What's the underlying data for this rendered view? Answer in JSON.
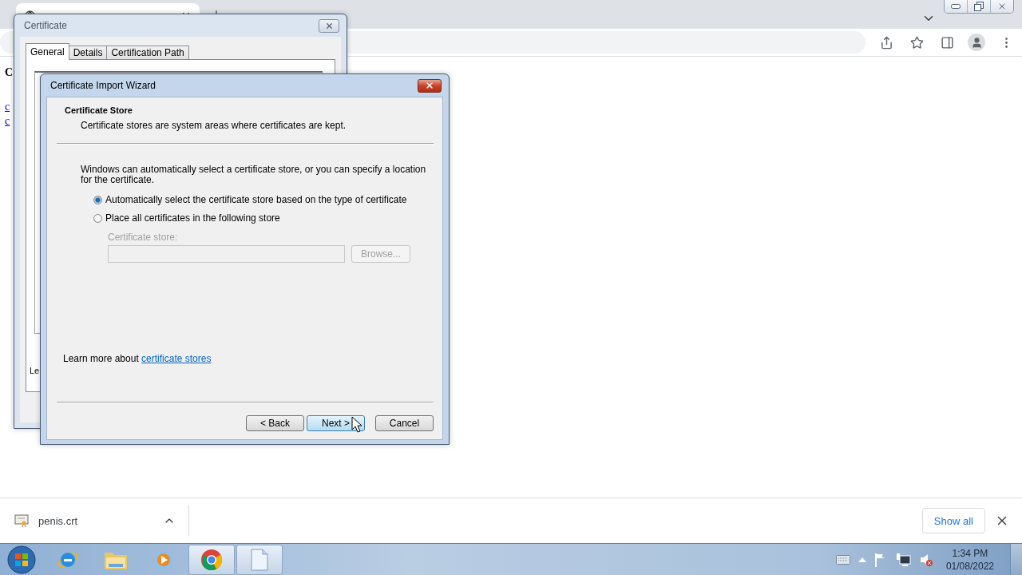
{
  "browser": {
    "page": {
      "heading": "C",
      "links": [
        "c",
        "c"
      ]
    }
  },
  "certificate_dialog": {
    "title": "Certificate",
    "tabs": [
      {
        "label": "General",
        "selected": true
      },
      {
        "label": "Details",
        "selected": false
      },
      {
        "label": "Certification Path",
        "selected": false
      }
    ],
    "fragment": "Le"
  },
  "wizard": {
    "title": "Certificate Import Wizard",
    "section_title": "Certificate Store",
    "section_subtitle": "Certificate stores are system areas where certificates are kept.",
    "intro": "Windows can automatically select a certificate store, or you can specify a location for the certificate.",
    "options": [
      {
        "label": "Automatically select the certificate store based on the type of certificate",
        "selected": true
      },
      {
        "label": "Place all certificates in the following store",
        "selected": false
      }
    ],
    "store": {
      "label": "Certificate store:",
      "disabled": true,
      "browse": "Browse..."
    },
    "learn_more": {
      "text": "Learn more about",
      "link": "certificate stores"
    },
    "buttons": [
      {
        "label": "< Back",
        "focused": false
      },
      {
        "label": "Next >",
        "focused": true
      },
      {
        "label": "Cancel",
        "focused": false
      }
    ]
  },
  "download_bar": {
    "file": "penis.crt",
    "show_all": "Show all"
  },
  "taskbar": {
    "apps": [
      {
        "kind": "ie",
        "active": false
      },
      {
        "kind": "folder",
        "active": false
      },
      {
        "kind": "media",
        "active": false
      },
      {
        "kind": "chrome",
        "active": true
      },
      {
        "kind": "document",
        "active": true
      }
    ],
    "clock": {
      "time": "1:34 PM",
      "date": "01/08/2022"
    }
  }
}
